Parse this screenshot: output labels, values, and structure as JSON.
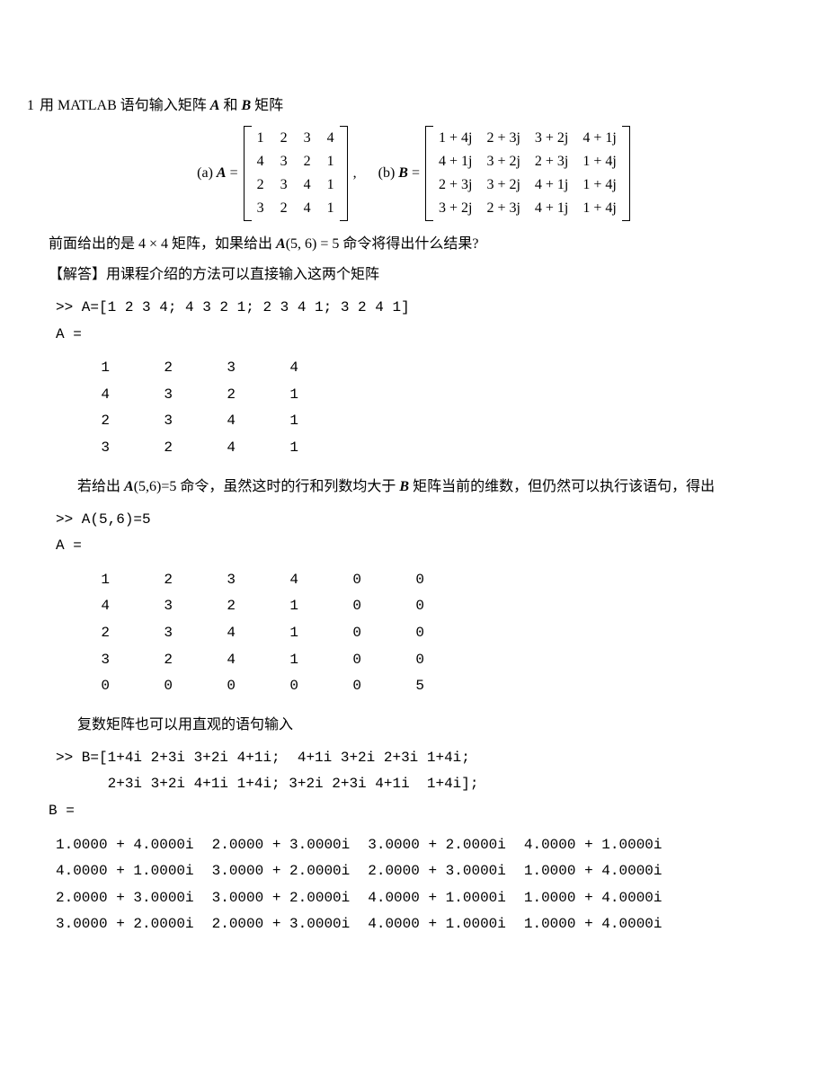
{
  "problem": {
    "number": "1",
    "text_before_A": "用 MATLAB 语句输入矩阵 ",
    "A": "A",
    "text_mid": " 和 ",
    "B": "B",
    "text_after": " 矩阵"
  },
  "matrices": {
    "label_a": "(a) ",
    "A_eq": "A",
    "eq": " = ",
    "A": [
      [
        "1",
        "2",
        "3",
        "4"
      ],
      [
        "4",
        "3",
        "2",
        "1"
      ],
      [
        "2",
        "3",
        "4",
        "1"
      ],
      [
        "3",
        "2",
        "4",
        "1"
      ]
    ],
    "comma": ",",
    "label_b": "(b) ",
    "B_eq": "B",
    "B": [
      [
        "1 + 4j",
        "2 + 3j",
        "3 + 2j",
        "4 + 1j"
      ],
      [
        "4 + 1j",
        "3 + 2j",
        "2 + 3j",
        "1 + 4j"
      ],
      [
        "2 + 3j",
        "3 + 2j",
        "4 + 1j",
        "1 + 4j"
      ],
      [
        "3 + 2j",
        "2 + 3j",
        "4 + 1j",
        "1 + 4j"
      ]
    ]
  },
  "question": {
    "before": "前面给出的是 4 × 4 矩阵，如果给出 ",
    "expr": "A",
    "expr_args": "(5, 6) = 5",
    "after": " 命令将得出什么结果?"
  },
  "answer": {
    "label": "【解答】",
    "text": "用课程介绍的方法可以直接输入这两个矩阵"
  },
  "code1": {
    "prompt": ">> A=[1 2 3 4; 4 3 2 1; 2 3 4 1; 3 2 4 1]",
    "result_label": "A =",
    "rows": [
      [
        "1",
        "2",
        "3",
        "4"
      ],
      [
        "4",
        "3",
        "2",
        "1"
      ],
      [
        "2",
        "3",
        "4",
        "1"
      ],
      [
        "3",
        "2",
        "4",
        "1"
      ]
    ]
  },
  "para2": {
    "before": "若给出 ",
    "expr": "A",
    "expr_args": "(5,6)=5",
    "mid": " 命令，虽然这时的行和列数均大于 ",
    "B": "B",
    "after": " 矩阵当前的维数，但仍然可以执行该语句，得出"
  },
  "code2": {
    "prompt": ">> A(5,6)=5",
    "result_label": "A =",
    "rows": [
      [
        "1",
        "2",
        "3",
        "4",
        "0",
        "0"
      ],
      [
        "4",
        "3",
        "2",
        "1",
        "0",
        "0"
      ],
      [
        "2",
        "3",
        "4",
        "1",
        "0",
        "0"
      ],
      [
        "3",
        "2",
        "4",
        "1",
        "0",
        "0"
      ],
      [
        "0",
        "0",
        "0",
        "0",
        "0",
        "5"
      ]
    ]
  },
  "para3": "复数矩阵也可以用直观的语句输入",
  "code3": {
    "line1": ">> B=[1+4i 2+3i 3+2i 4+1i;  4+1i 3+2i 2+3i 1+4i;",
    "line2": "      2+3i 3+2i 4+1i 1+4i; 3+2i 2+3i 4+1i  1+4i];",
    "result_label": "B =",
    "rows": [
      [
        "1.0000 + 4.0000i",
        "2.0000 + 3.0000i",
        "3.0000 + 2.0000i",
        "4.0000 + 1.0000i"
      ],
      [
        "4.0000 + 1.0000i",
        "3.0000 + 2.0000i",
        "2.0000 + 3.0000i",
        "1.0000 + 4.0000i"
      ],
      [
        "2.0000 + 3.0000i",
        "3.0000 + 2.0000i",
        "4.0000 + 1.0000i",
        "1.0000 + 4.0000i"
      ],
      [
        "3.0000 + 2.0000i",
        "2.0000 + 3.0000i",
        "4.0000 + 1.0000i",
        "1.0000 + 4.0000i"
      ]
    ]
  }
}
